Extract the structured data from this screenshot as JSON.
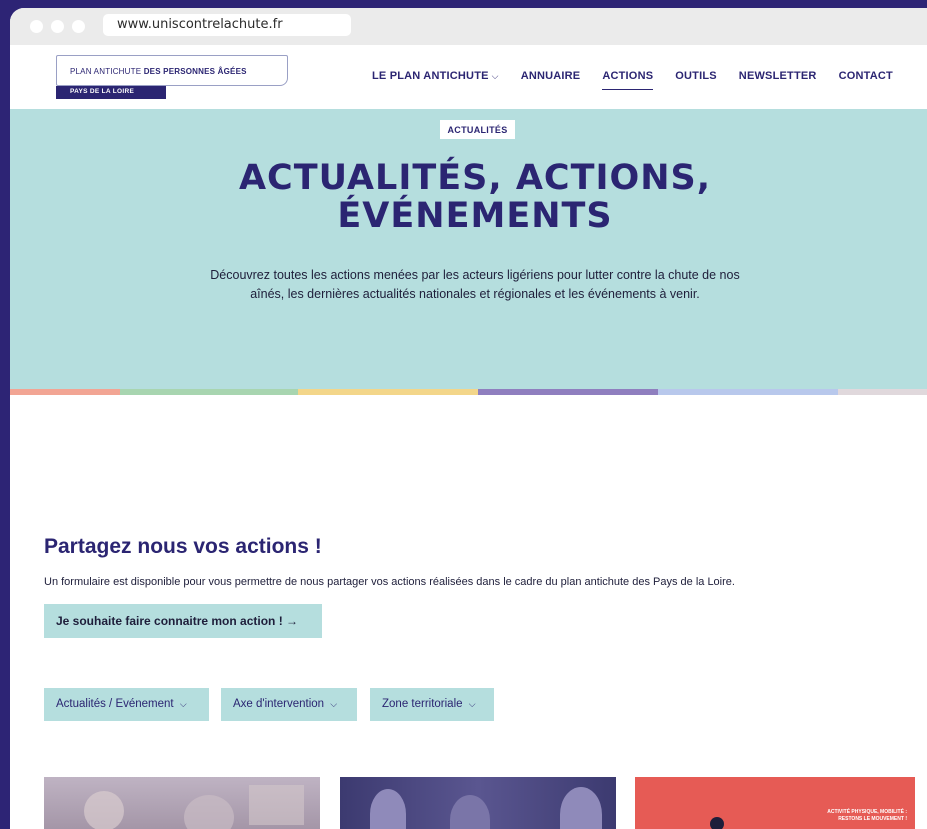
{
  "browser": {
    "url": "www.uniscontrelachute.fr"
  },
  "logo": {
    "line1_light": "PLAN ANTICHUTE",
    "line1_bold": "DES PERSONNES ÂGÉES",
    "tag": "PAYS DE LA LOIRE"
  },
  "nav": {
    "items": [
      {
        "label": "LE PLAN ANTICHUTE",
        "has_dropdown": true
      },
      {
        "label": "ANNUAIRE"
      },
      {
        "label": "ACTIONS",
        "active": true
      },
      {
        "label": "OUTILS"
      },
      {
        "label": "NEWSLETTER"
      },
      {
        "label": "CONTACT"
      }
    ],
    "dropdown_glyph": "⌵"
  },
  "hero": {
    "tag": "ACTUALITÉS",
    "title_line1": "ACTUALITÉS, ACTIONS,",
    "title_line2": "ÉVÉNEMENTS",
    "description": "Découvrez toutes les actions menées par les acteurs ligériens pour lutter contre la chute de nos aînés, les dernières actualités nationales et régionales et les événements à venir."
  },
  "stripe_colors": [
    "#f2a594",
    "#a8d5b0",
    "#f3d68a",
    "#8f7fbf",
    "#b8c8ec",
    "#e0d8dc"
  ],
  "share": {
    "title": "Partagez nous vos actions !",
    "description": "Un formulaire est disponible pour vous permettre de nous partager vos actions réalisées dans le cadre du plan antichute des Pays de la Loire.",
    "cta_label": "Je souhaite faire connaitre mon action ! →"
  },
  "filters": [
    {
      "label": "Actualités / Evénement"
    },
    {
      "label": "Axe d'intervention"
    },
    {
      "label": "Zone territoriale"
    }
  ],
  "cards": [
    {
      "caption": ""
    },
    {
      "caption": ""
    },
    {
      "caption": "ACTIVITÉ PHYSIQUE, MOBILITÉ : RESTONS LE MOUVEMENT !"
    }
  ],
  "colors": {
    "brand": "#2b2572",
    "hero_bg": "#b5dede",
    "card3": "#e65b55"
  }
}
